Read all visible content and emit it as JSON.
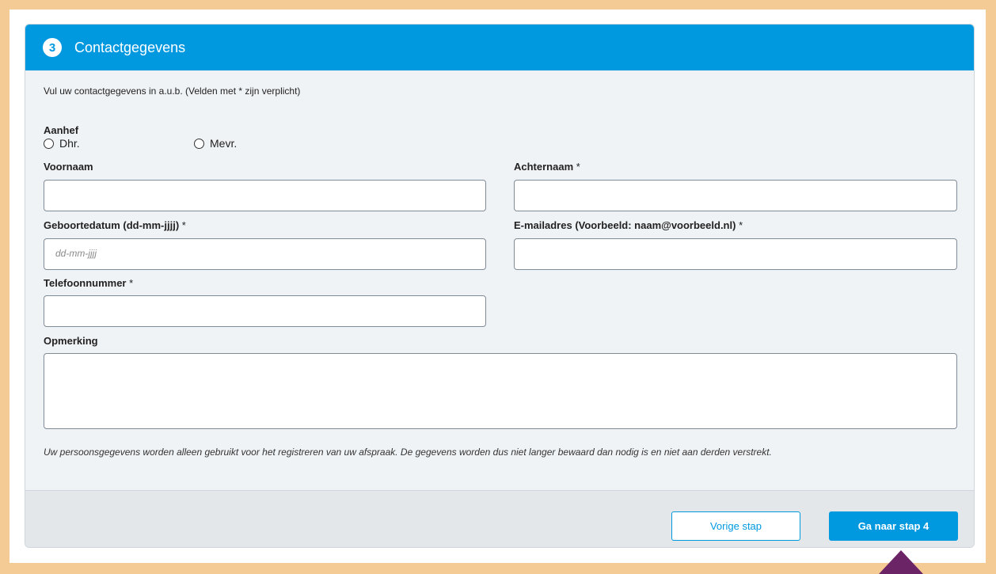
{
  "header": {
    "step_number": "3",
    "title": "Contactgegevens"
  },
  "form": {
    "intro": "Vul uw contactgegevens in a.u.b. (Velden met * zijn verplicht)",
    "salutation": {
      "label": "Aanhef",
      "options": [
        "Dhr.",
        "Mevr."
      ]
    },
    "first_name": {
      "label": "Voornaam",
      "value": ""
    },
    "last_name": {
      "label": "Achternaam",
      "required_mark": "*",
      "value": ""
    },
    "birthdate": {
      "label": "Geboortedatum (dd-mm-jjjj)",
      "required_mark": "*",
      "placeholder": "dd-mm-jjjj",
      "value": ""
    },
    "email": {
      "label": "E-mailadres (Voorbeeld: naam@voorbeeld.nl)",
      "required_mark": "*",
      "value": ""
    },
    "phone": {
      "label": "Telefoonnummer",
      "required_mark": "*",
      "value": ""
    },
    "remark": {
      "label": "Opmerking",
      "value": ""
    },
    "privacy_note": "Uw persoonsgegevens worden alleen gebruikt voor het registreren van uw afspraak. De gegevens worden dus niet langer bewaard dan nodig is en niet aan derden verstrekt."
  },
  "footer": {
    "back_label": "Vorige stap",
    "next_label": "Ga naar stap 4"
  },
  "colors": {
    "accent": "#0099e0",
    "page_border": "#f5cb95",
    "pointer": "#6b2466"
  }
}
